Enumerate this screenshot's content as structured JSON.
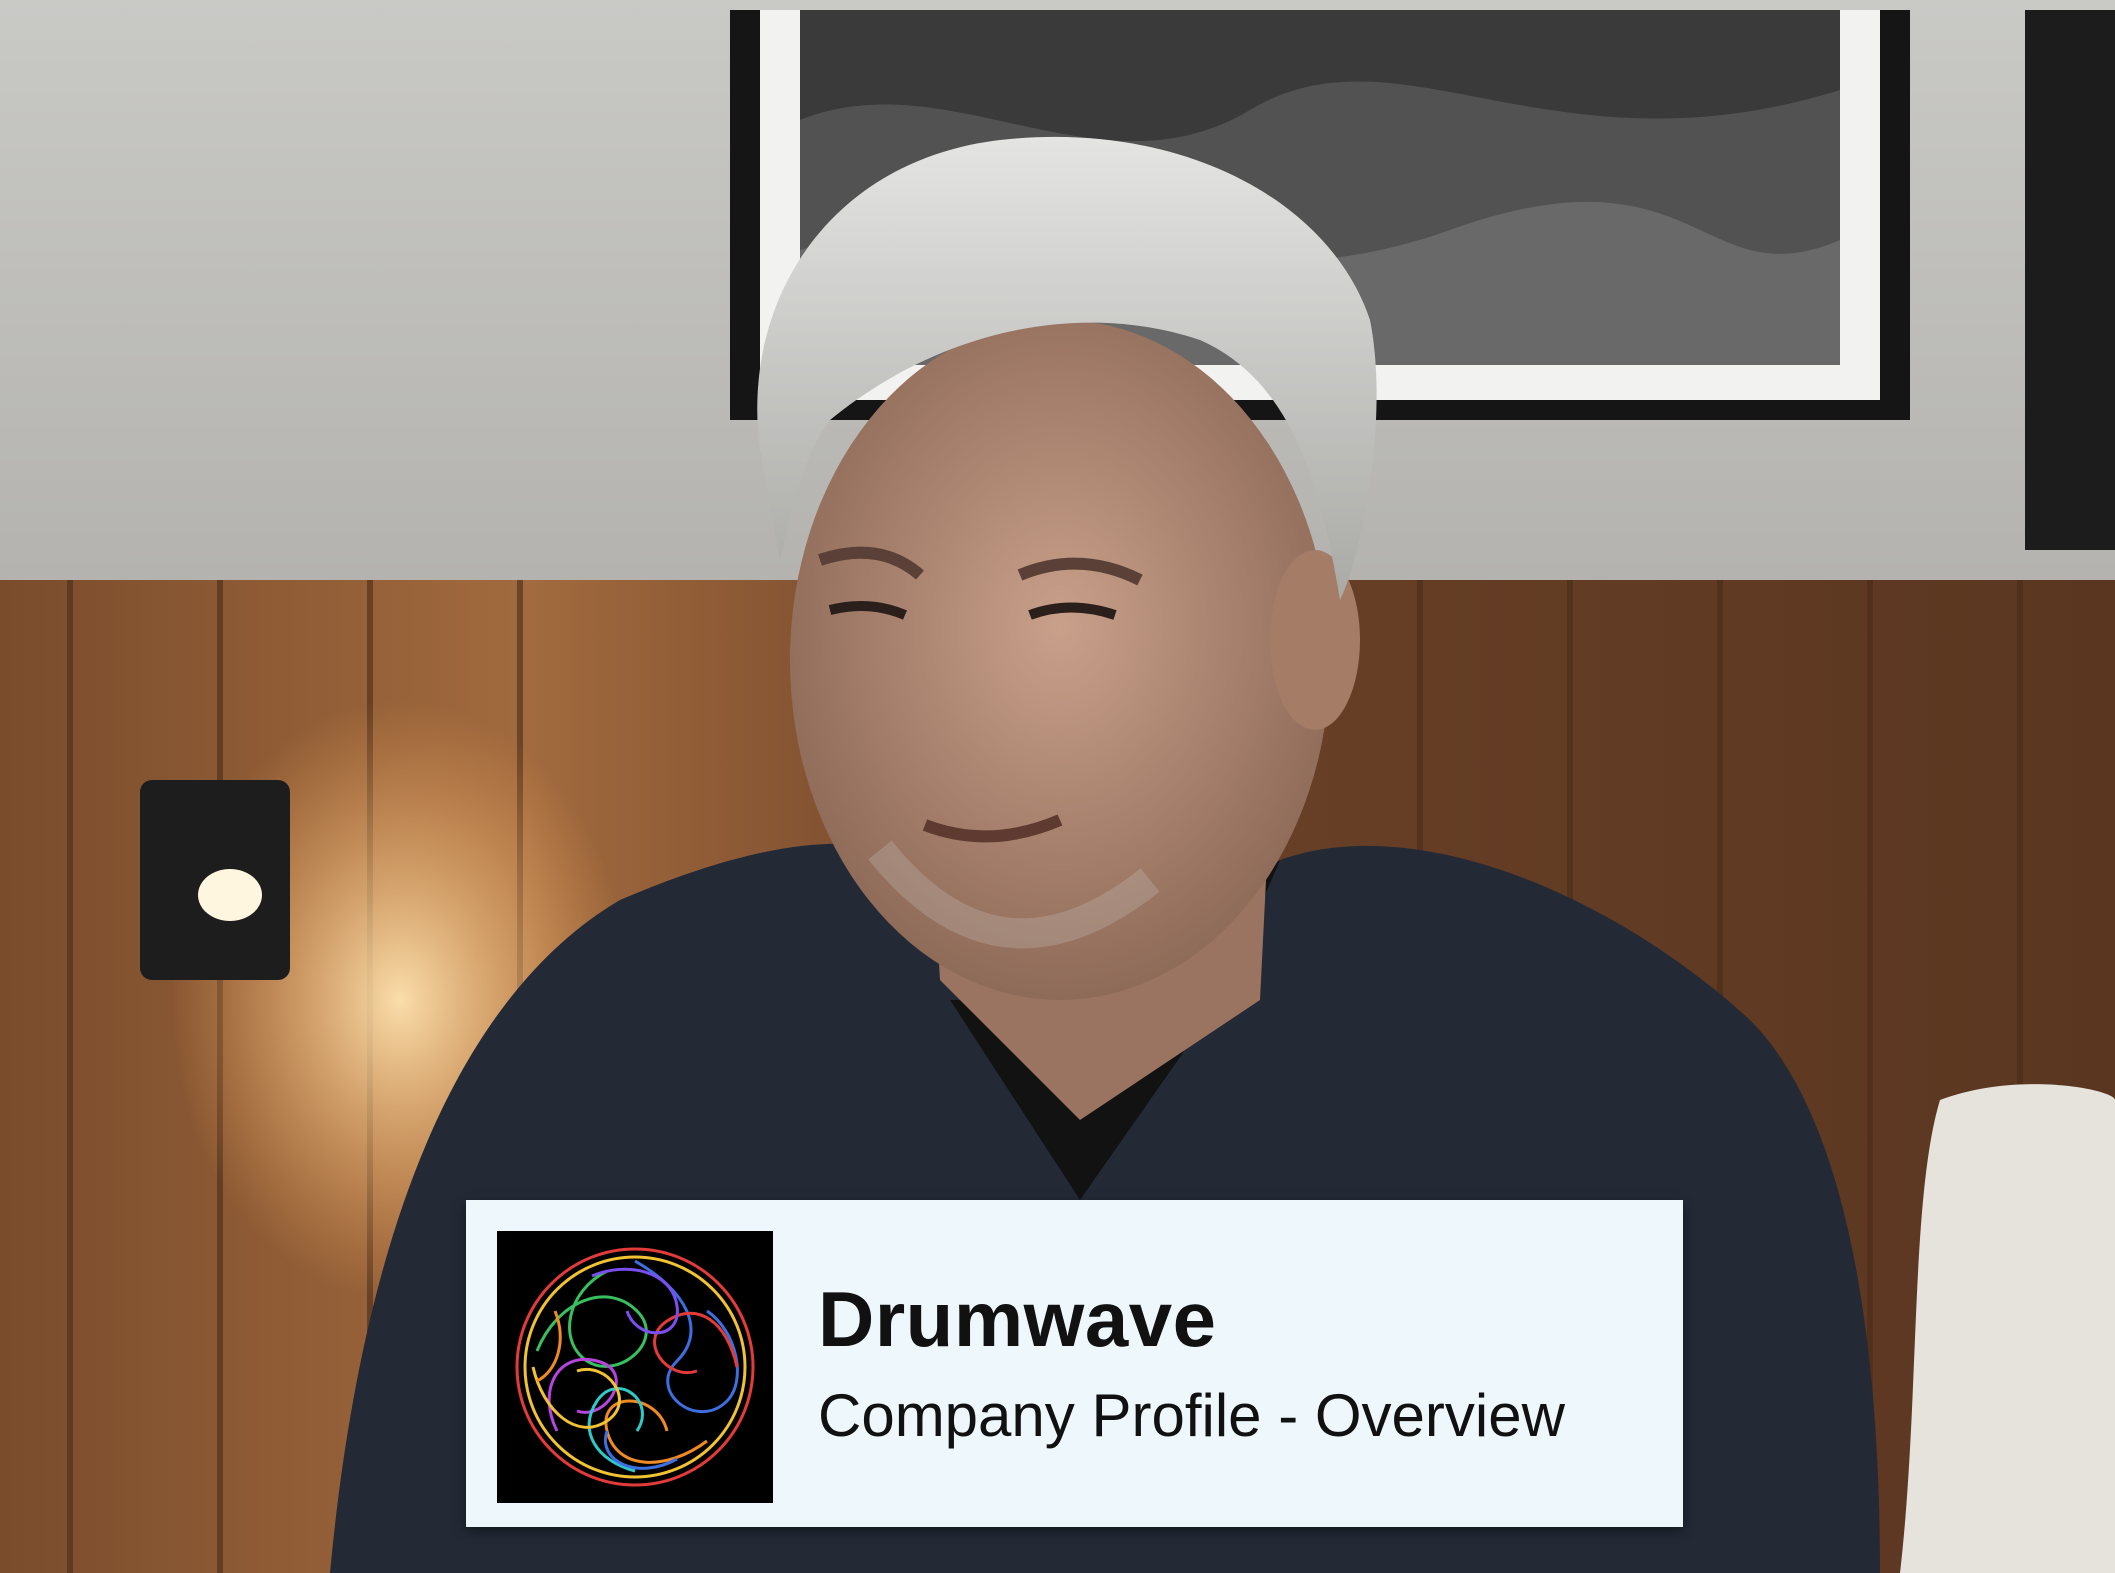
{
  "video_frame": {
    "scene_description_icon": "interview-scene"
  },
  "lower_third": {
    "company_name": "Drumwave",
    "subtitle": "Company Profile - Overview",
    "logo_icon": "drumwave-logo-icon"
  },
  "colors": {
    "banner_bg": "#eef8fc",
    "text": "#111111",
    "logo_bg": "#000000"
  }
}
